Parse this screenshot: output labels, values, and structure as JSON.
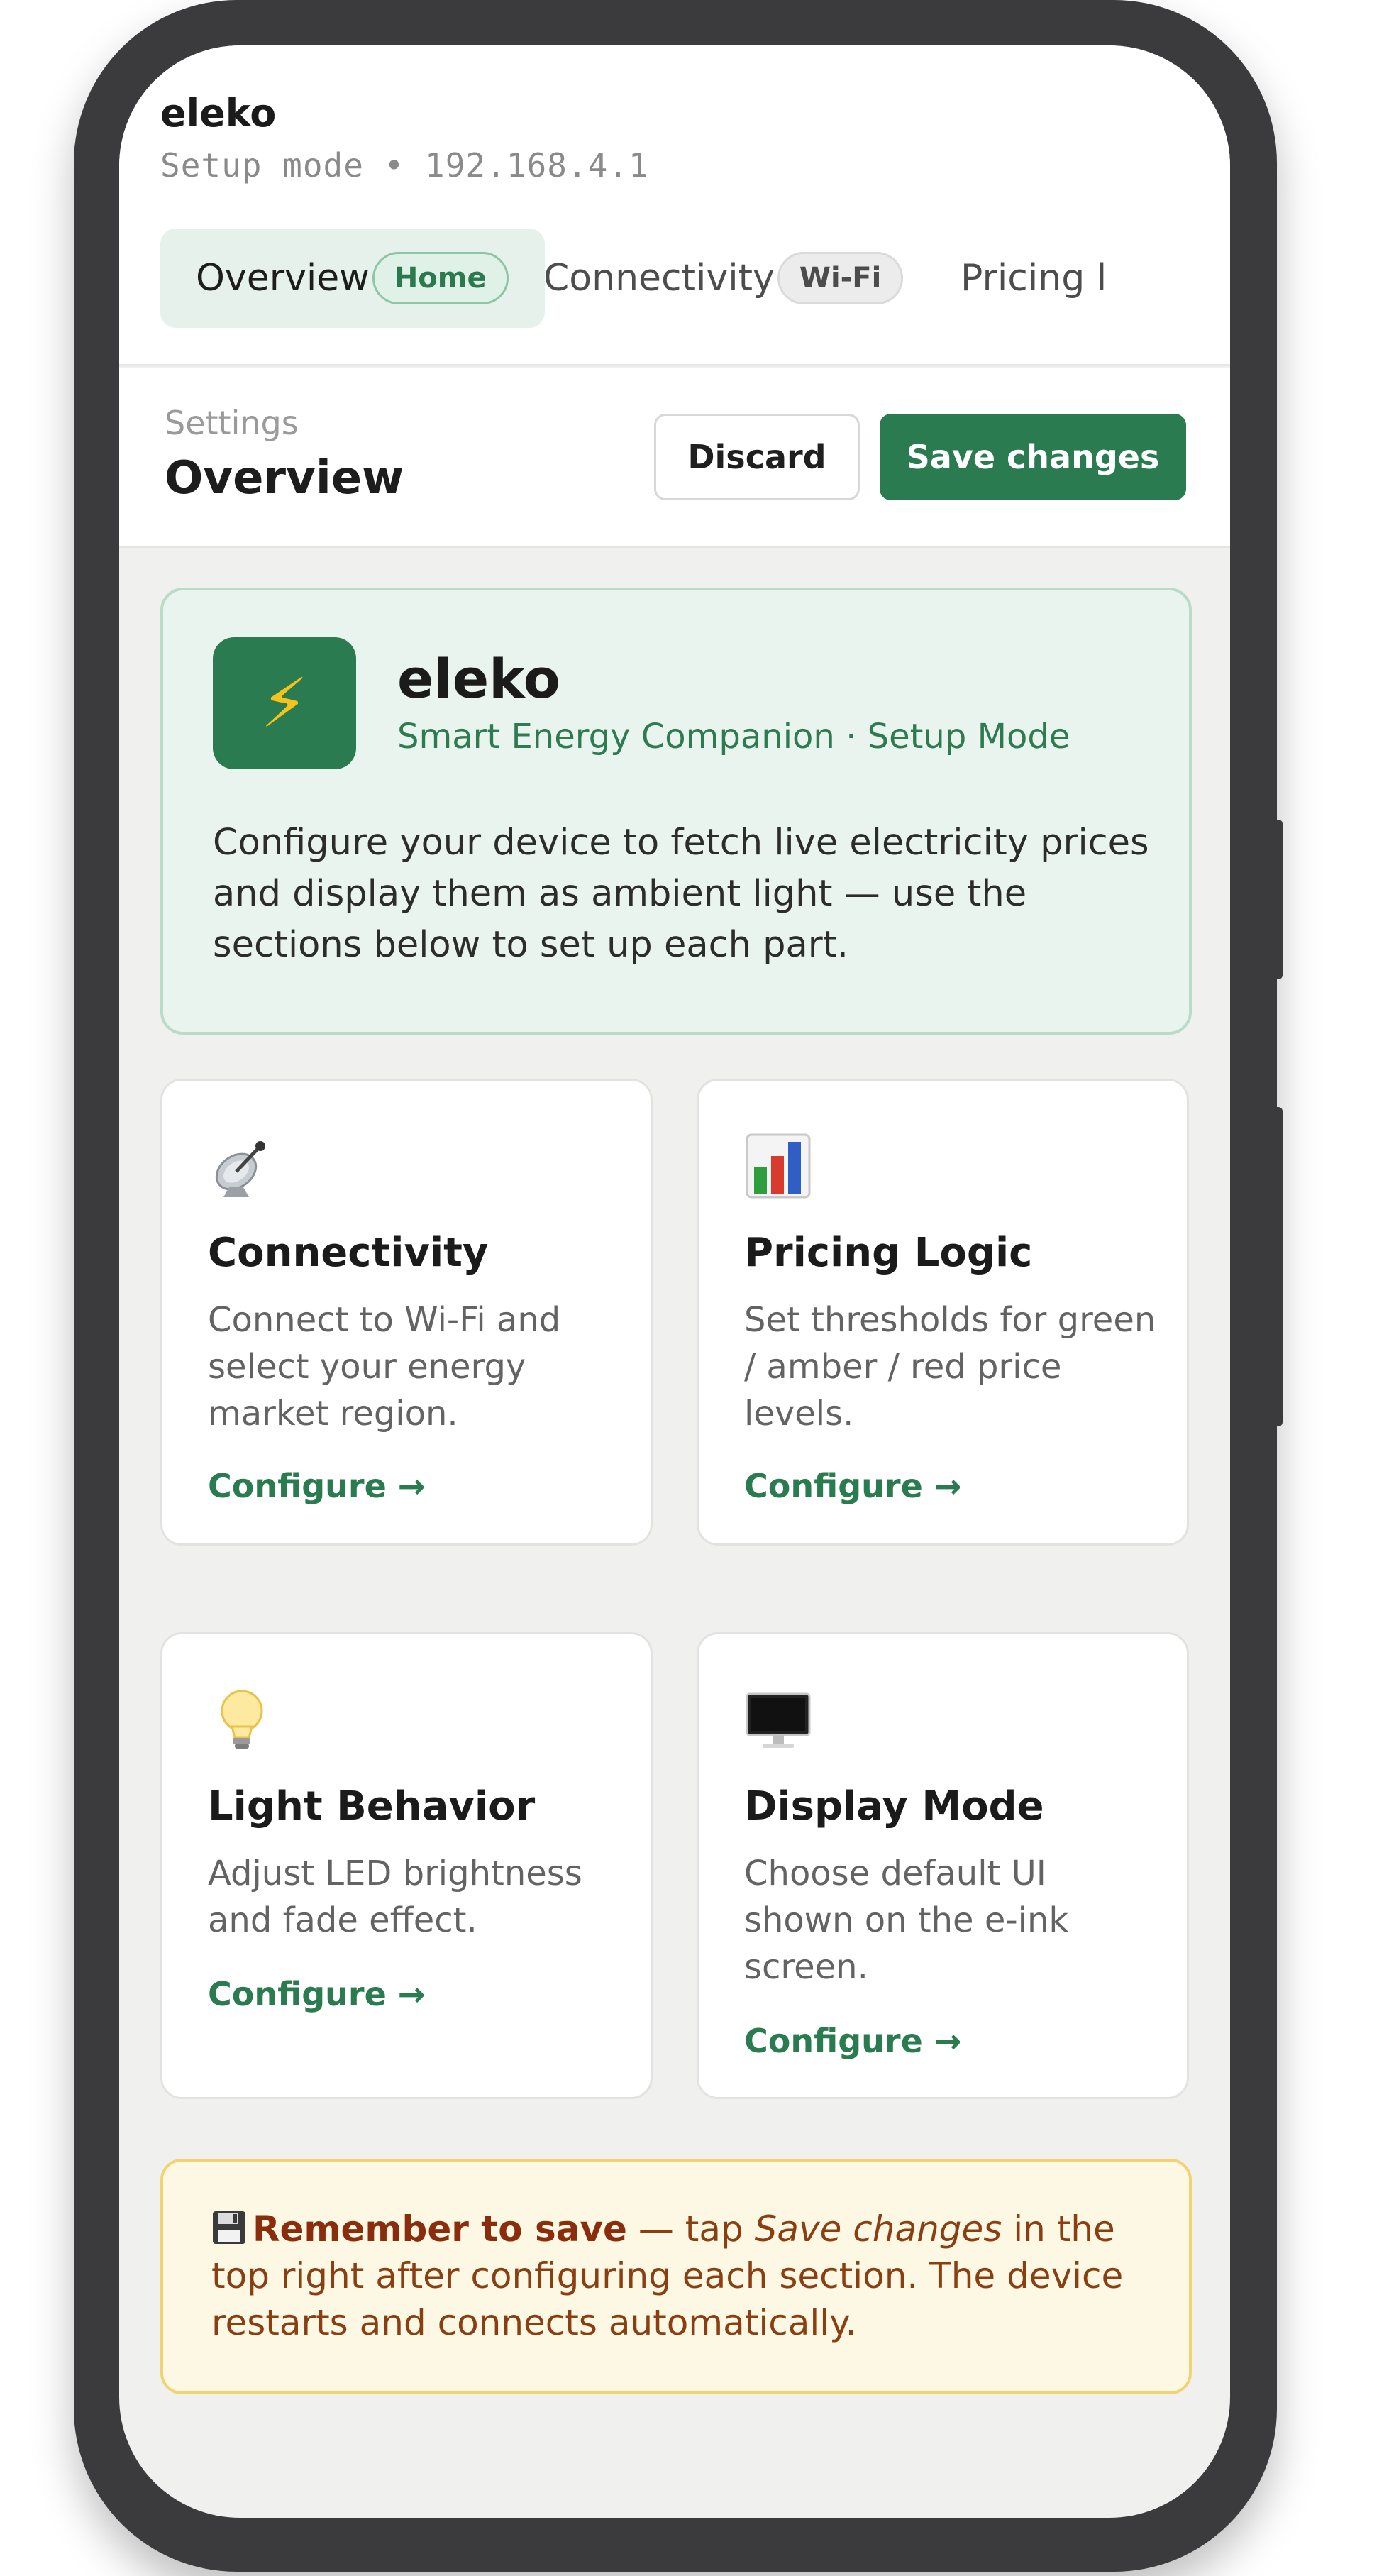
{
  "app": {
    "brand": "eleko",
    "mode_line": "Setup mode • 192.168.4.1"
  },
  "tabs": [
    {
      "label": "Overview",
      "badge": "Home",
      "active": true
    },
    {
      "label": "Connectivity",
      "badge": "Wi-Fi",
      "active": false
    },
    {
      "label": "Pricing l",
      "badge": "",
      "active": false
    }
  ],
  "settings_bar": {
    "breadcrumb": "Settings",
    "title": "Overview",
    "discard_label": "Discard",
    "save_label": "Save changes"
  },
  "hero": {
    "logo_icon": "lightning-bolt-icon",
    "logo_glyph": "⚡",
    "title": "eleko",
    "subtitle": "Smart Energy Companion · Setup Mode",
    "description": "Configure your device to fetch live electricity prices and display them as ambient light — use the sections below to set up each part."
  },
  "cards": [
    {
      "icon": "satellite-dish-icon",
      "title": "Connectivity",
      "description": "Connect to Wi-Fi and select your energy market region.",
      "link": "Configure →"
    },
    {
      "icon": "bar-chart-icon",
      "title": "Pricing Logic",
      "description": "Set thresholds for green / amber / red price levels.",
      "link": "Configure →"
    },
    {
      "icon": "light-bulb-icon",
      "title": "Light Behavior",
      "description": "Adjust LED brightness and fade effect.",
      "link": "Configure →"
    },
    {
      "icon": "monitor-icon",
      "title": "Display Mode",
      "description": "Choose default UI shown on the e-ink screen.",
      "link": "Configure →"
    }
  ],
  "reminder": {
    "icon": "floppy-disk-icon",
    "strong": "Remember to save",
    "text_before": " — tap ",
    "emphasis": "Save changes",
    "text_after": " in the top right after configuring each section. The device restarts and connects automatically."
  },
  "colors": {
    "accent": "#2b7b50",
    "hero_bg": "#e9f4ee",
    "reminder_bg": "#fdf8e4",
    "reminder_border": "#f2d371"
  }
}
